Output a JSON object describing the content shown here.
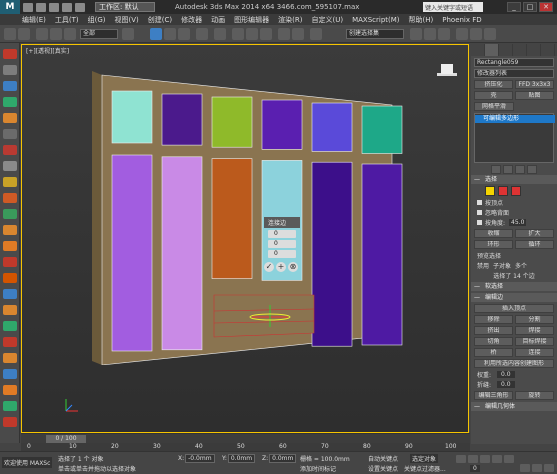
{
  "title": {
    "workspace_label": "工作区: 默认",
    "window_title": "Autodesk 3ds Max  2014 x64     3466.com_595107.max",
    "search_placeholder": "键入关键字或短语",
    "min_label": "_",
    "max_label": "□",
    "close_label": "✕"
  },
  "menu": [
    "编辑(E)",
    "工具(T)",
    "组(G)",
    "视图(V)",
    "创建(C)",
    "修改器",
    "动画",
    "图形编辑器",
    "渲染(R)",
    "自定义(U)",
    "MAXScript(M)",
    "帮助(H)",
    "Phoenix FD"
  ],
  "toolbar": {
    "selection_filter": "全部",
    "named_selection": "创建选择集"
  },
  "viewport": {
    "label": "[+][透视][真实]",
    "popup": {
      "title": "连接边",
      "spin1": "0",
      "spin2": "0",
      "spin3": "0",
      "ok": "✓",
      "apply": "+",
      "cancel": "⊗"
    }
  },
  "panel": {
    "object_name": "Rectangle059",
    "modifier_list": "修改器列表",
    "btn_unwrap": "挤压化",
    "btn_ffd": "FFD 3x3x3",
    "btn_shell": "壳",
    "btn_uvw": "贴图",
    "btn_smooth": "网格平滑",
    "stack_item": "可编辑多边形",
    "rollout_select": "选择",
    "cb_by_vertex": "按顶点",
    "cb_ignore_back": "忽略背面",
    "cb_by_angle": "按角度:",
    "angle_value": "45.0",
    "btn_shrink": "收缩",
    "btn_grow": "扩大",
    "btn_ring": "环形",
    "btn_loop": "循环",
    "preview_label": "预览选择",
    "preview_opts": [
      "禁用",
      "子对象",
      "多个"
    ],
    "sel_status": "选择了 14 个边",
    "rollout_soft": "软选择",
    "rollout_edit": "编辑边",
    "insert_vertex": "插入顶点",
    "btn_remove": "移除",
    "btn_split": "分割",
    "btn_extrude": "挤出",
    "btn_weld": "焊接",
    "btn_chamfer": "切角",
    "btn_target_weld": "目标焊接",
    "btn_bridge": "桥",
    "btn_connect": "连接",
    "create_shape": "利用所选内容创建图形",
    "weight_label": "权重:",
    "weight_value": "0.0",
    "crease_label": "折缝:",
    "crease_value": "0.0",
    "btn_edit_tri": "编辑三角形",
    "btn_rotate": "旋转",
    "rollout_geom": "编辑几何体"
  },
  "timeline": {
    "slider": "0 / 100",
    "ticks": [
      "0",
      "10",
      "20",
      "30",
      "40",
      "50",
      "60",
      "70",
      "80",
      "90",
      "100"
    ]
  },
  "status": {
    "maxscript": "欢迎使用 MAXSc",
    "prompt1": "选择了 1 个 对象",
    "prompt2": "单击或单击并拖动以选择对象",
    "x_label": "X:",
    "x_value": "-0.0mm",
    "y_label": "Y:",
    "y_value": "0.0mm",
    "z_label": "Z:",
    "z_value": "0.0mm",
    "grid": "栅格 = 100.0mm",
    "add_tag": "添加时间标记",
    "autokey": "自动关键点",
    "selected": "选定对象",
    "setkey": "设置关键点",
    "keyfilter": "关键点过滤器...",
    "frame": "0"
  },
  "colors": {
    "accent_blue": "#1e78c8",
    "viewport_border": "#f5c400",
    "frame_wood": "#8a7450"
  },
  "wardrobe_doors": {
    "top_colors": [
      "#8fe3d2",
      "#4b1a8c",
      "#8fba2a",
      "#5a1fb0",
      "#5a4ad9",
      "#1ea888"
    ],
    "bottom_colors": [
      "#a25de0",
      "#c98ae6",
      "#bb5a1c",
      "#8cd2dc",
      "#3c0f8a",
      "#4e1aa3"
    ]
  }
}
